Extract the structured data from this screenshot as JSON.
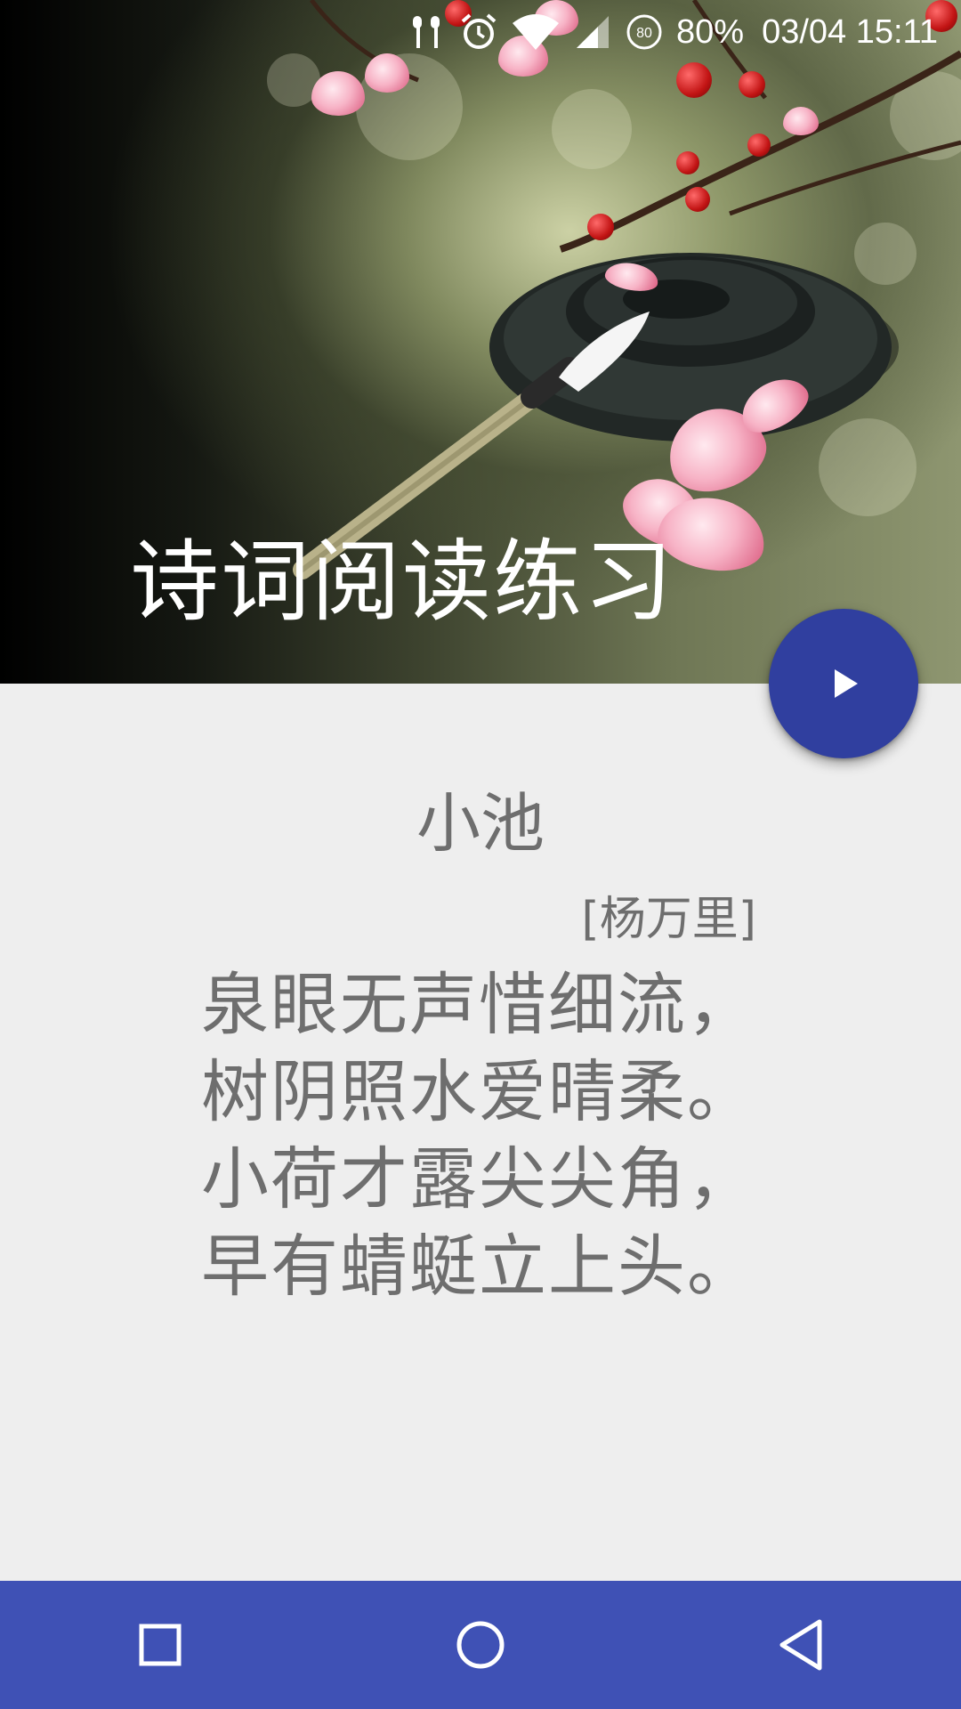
{
  "status_bar": {
    "battery_text": "80%",
    "datetime": "03/04 15:11",
    "icons": [
      "earbuds-icon",
      "alarm-icon",
      "wifi-icon",
      "signal-icon",
      "battery-saver-icon"
    ],
    "battery_saver_badge": "80"
  },
  "header": {
    "title": "诗词阅读练习"
  },
  "fab": {
    "icon": "play-icon",
    "color": "#303f9f"
  },
  "poem": {
    "title": "小池",
    "author": "[杨万里]",
    "lines": [
      "泉眼无声惜细流，",
      "树阴照水爱晴柔。",
      "小荷才露尖尖角，",
      "早有蜻蜓立上头。"
    ]
  },
  "nav_bar": {
    "color": "#3f51b5",
    "buttons": [
      "recents-icon",
      "home-icon",
      "back-icon"
    ]
  }
}
